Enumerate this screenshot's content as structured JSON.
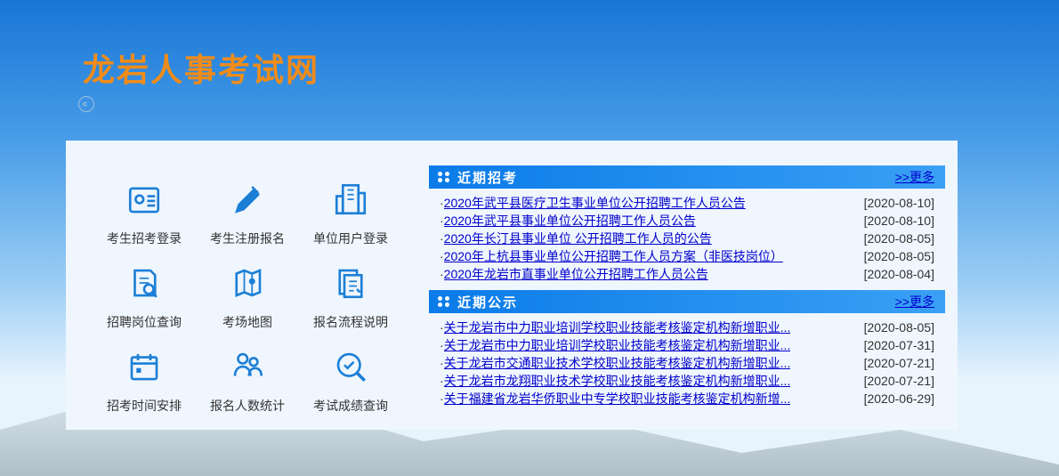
{
  "site_title": "龙岩人事考试网",
  "icons": [
    {
      "key": "login",
      "label": "考生招考登录"
    },
    {
      "key": "register",
      "label": "考生注册报名"
    },
    {
      "key": "org",
      "label": "单位用户登录"
    },
    {
      "key": "jobs",
      "label": "招聘岗位查询"
    },
    {
      "key": "map",
      "label": "考场地图"
    },
    {
      "key": "flow",
      "label": "报名流程说明"
    },
    {
      "key": "schedule",
      "label": "招考时间安排"
    },
    {
      "key": "stats",
      "label": "报名人数统计"
    },
    {
      "key": "score",
      "label": "考试成绩查询"
    }
  ],
  "section1": {
    "title": "近期招考",
    "more": ">>更多",
    "items": [
      {
        "title": "2020年武平县医疗卫生事业单位公开招聘工作人员公告",
        "date": "[2020-08-10]"
      },
      {
        "title": "2020年武平县事业单位公开招聘工作人员公告",
        "date": "[2020-08-10]"
      },
      {
        "title": "2020年长汀县事业单位 公开招聘工作人员的公告",
        "date": "[2020-08-05]"
      },
      {
        "title": "2020年上杭县事业单位公开招聘工作人员方案（非医技岗位）",
        "date": "[2020-08-05]"
      },
      {
        "title": "2020年龙岩市直事业单位公开招聘工作人员公告",
        "date": "[2020-08-04]"
      }
    ]
  },
  "section2": {
    "title": "近期公示",
    "more": ">>更多",
    "items": [
      {
        "title": "关于龙岩市中力职业培训学校职业技能考核鉴定机构新增职业...",
        "date": "[2020-08-05]"
      },
      {
        "title": "关于龙岩市中力职业培训学校职业技能考核鉴定机构新增职业...",
        "date": "[2020-07-31]"
      },
      {
        "title": "关于龙岩市交通职业技术学校职业技能考核鉴定机构新增职业...",
        "date": "[2020-07-21]"
      },
      {
        "title": "关于龙岩市龙翔职业技术学校职业技能考核鉴定机构新增职业...",
        "date": "[2020-07-21]"
      },
      {
        "title": "关于福建省龙岩华侨职业中专学校职业技能考核鉴定机构新增...",
        "date": "[2020-06-29]"
      }
    ]
  }
}
